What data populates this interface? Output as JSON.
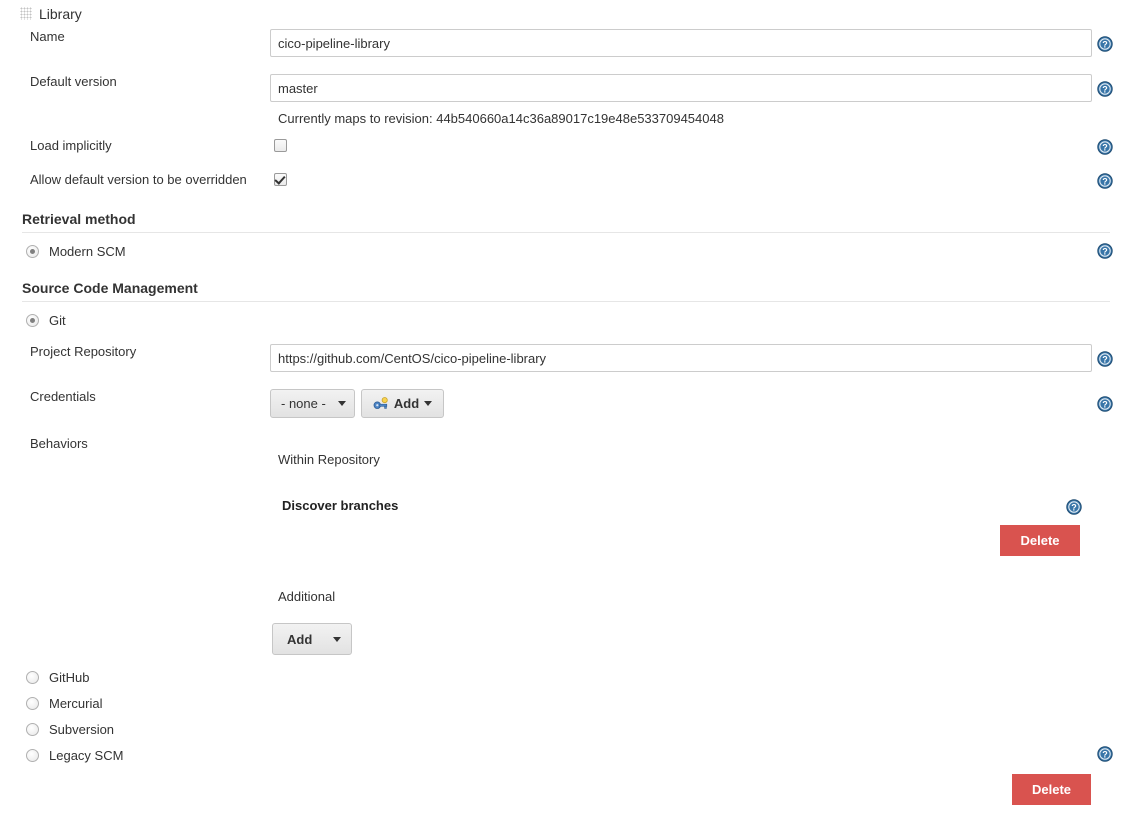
{
  "header": {
    "title": "Library",
    "grip_icon": "drag-handle-icon"
  },
  "fields": {
    "name": {
      "label": "Name",
      "value": "cico-pipeline-library",
      "help_icon": "help-icon"
    },
    "default_version": {
      "label": "Default version",
      "value": "master",
      "hint": "Currently maps to revision: 44b540660a14c36a89017c19e48e533709454048",
      "help_icon": "help-icon"
    },
    "load_implicitly": {
      "label": "Load implicitly",
      "checked": false,
      "help_icon": "help-icon"
    },
    "allow_override": {
      "label": "Allow default version to be overridden",
      "checked": true,
      "help_icon": "help-icon"
    }
  },
  "retrieval_method": {
    "title": "Retrieval method",
    "options": [
      {
        "label": "Modern SCM",
        "selected": true,
        "help_icon": "help-icon"
      }
    ]
  },
  "source_code_management": {
    "title": "Source Code Management",
    "primary_option": {
      "label": "Git",
      "selected": true
    },
    "project_repository": {
      "label": "Project Repository",
      "value": "https://github.com/CentOS/cico-pipeline-library",
      "help_icon": "help-icon"
    },
    "credentials": {
      "label": "Credentials",
      "selected_value": "- none -",
      "options": [
        "- none -"
      ],
      "add_button_label": "Add",
      "add_button_icon": "key-icon",
      "help_icon": "help-icon"
    },
    "behaviors": {
      "label": "Behaviors",
      "groups": [
        {
          "group_label": "Within Repository",
          "items": [
            {
              "name": "Discover branches",
              "help_icon": "help-icon",
              "delete_label": "Delete"
            }
          ]
        },
        {
          "group_label": "Additional",
          "add_button_label": "Add"
        }
      ]
    },
    "other_options": [
      {
        "label": "GitHub",
        "selected": false
      },
      {
        "label": "Mercurial",
        "selected": false
      },
      {
        "label": "Subversion",
        "selected": false
      },
      {
        "label": "Legacy SCM",
        "selected": false,
        "help_icon": "help-icon"
      }
    ]
  },
  "footer": {
    "delete_label": "Delete"
  },
  "colors": {
    "danger": "#d9534f",
    "help_blue": "#2b6fb5",
    "divider": "#e6e6e6",
    "text": "#333333"
  }
}
